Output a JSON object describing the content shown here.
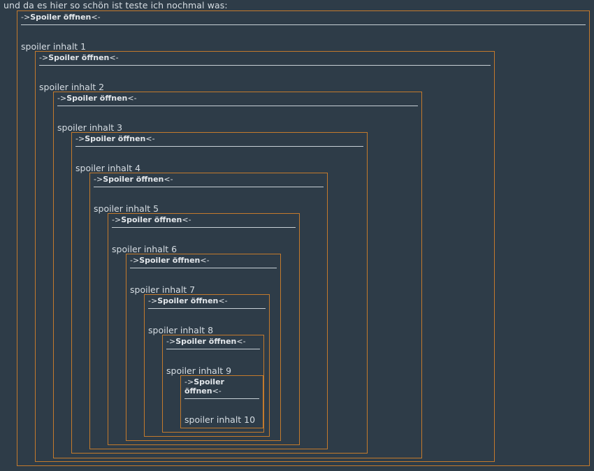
{
  "intro_text": "und da es hier so schön ist teste ich nochmal was:",
  "spoiler": {
    "prefix": "->",
    "title": "Spoiler öffnen",
    "suffix": "<-"
  },
  "spoilers": [
    {
      "content": "spoiler inhalt 1"
    },
    {
      "content": "spoiler inhalt 2"
    },
    {
      "content": "spoiler inhalt 3"
    },
    {
      "content": "spoiler inhalt 4"
    },
    {
      "content": "spoiler inhalt 5"
    },
    {
      "content": "spoiler inhalt 6"
    },
    {
      "content": "spoiler inhalt 7"
    },
    {
      "content": "spoiler inhalt 8"
    },
    {
      "content": "spoiler inhalt 9"
    },
    {
      "content": "spoiler inhalt 10"
    }
  ],
  "colors": {
    "background": "#2e3c48",
    "border": "#c47a2c",
    "text": "#d6dde3"
  }
}
